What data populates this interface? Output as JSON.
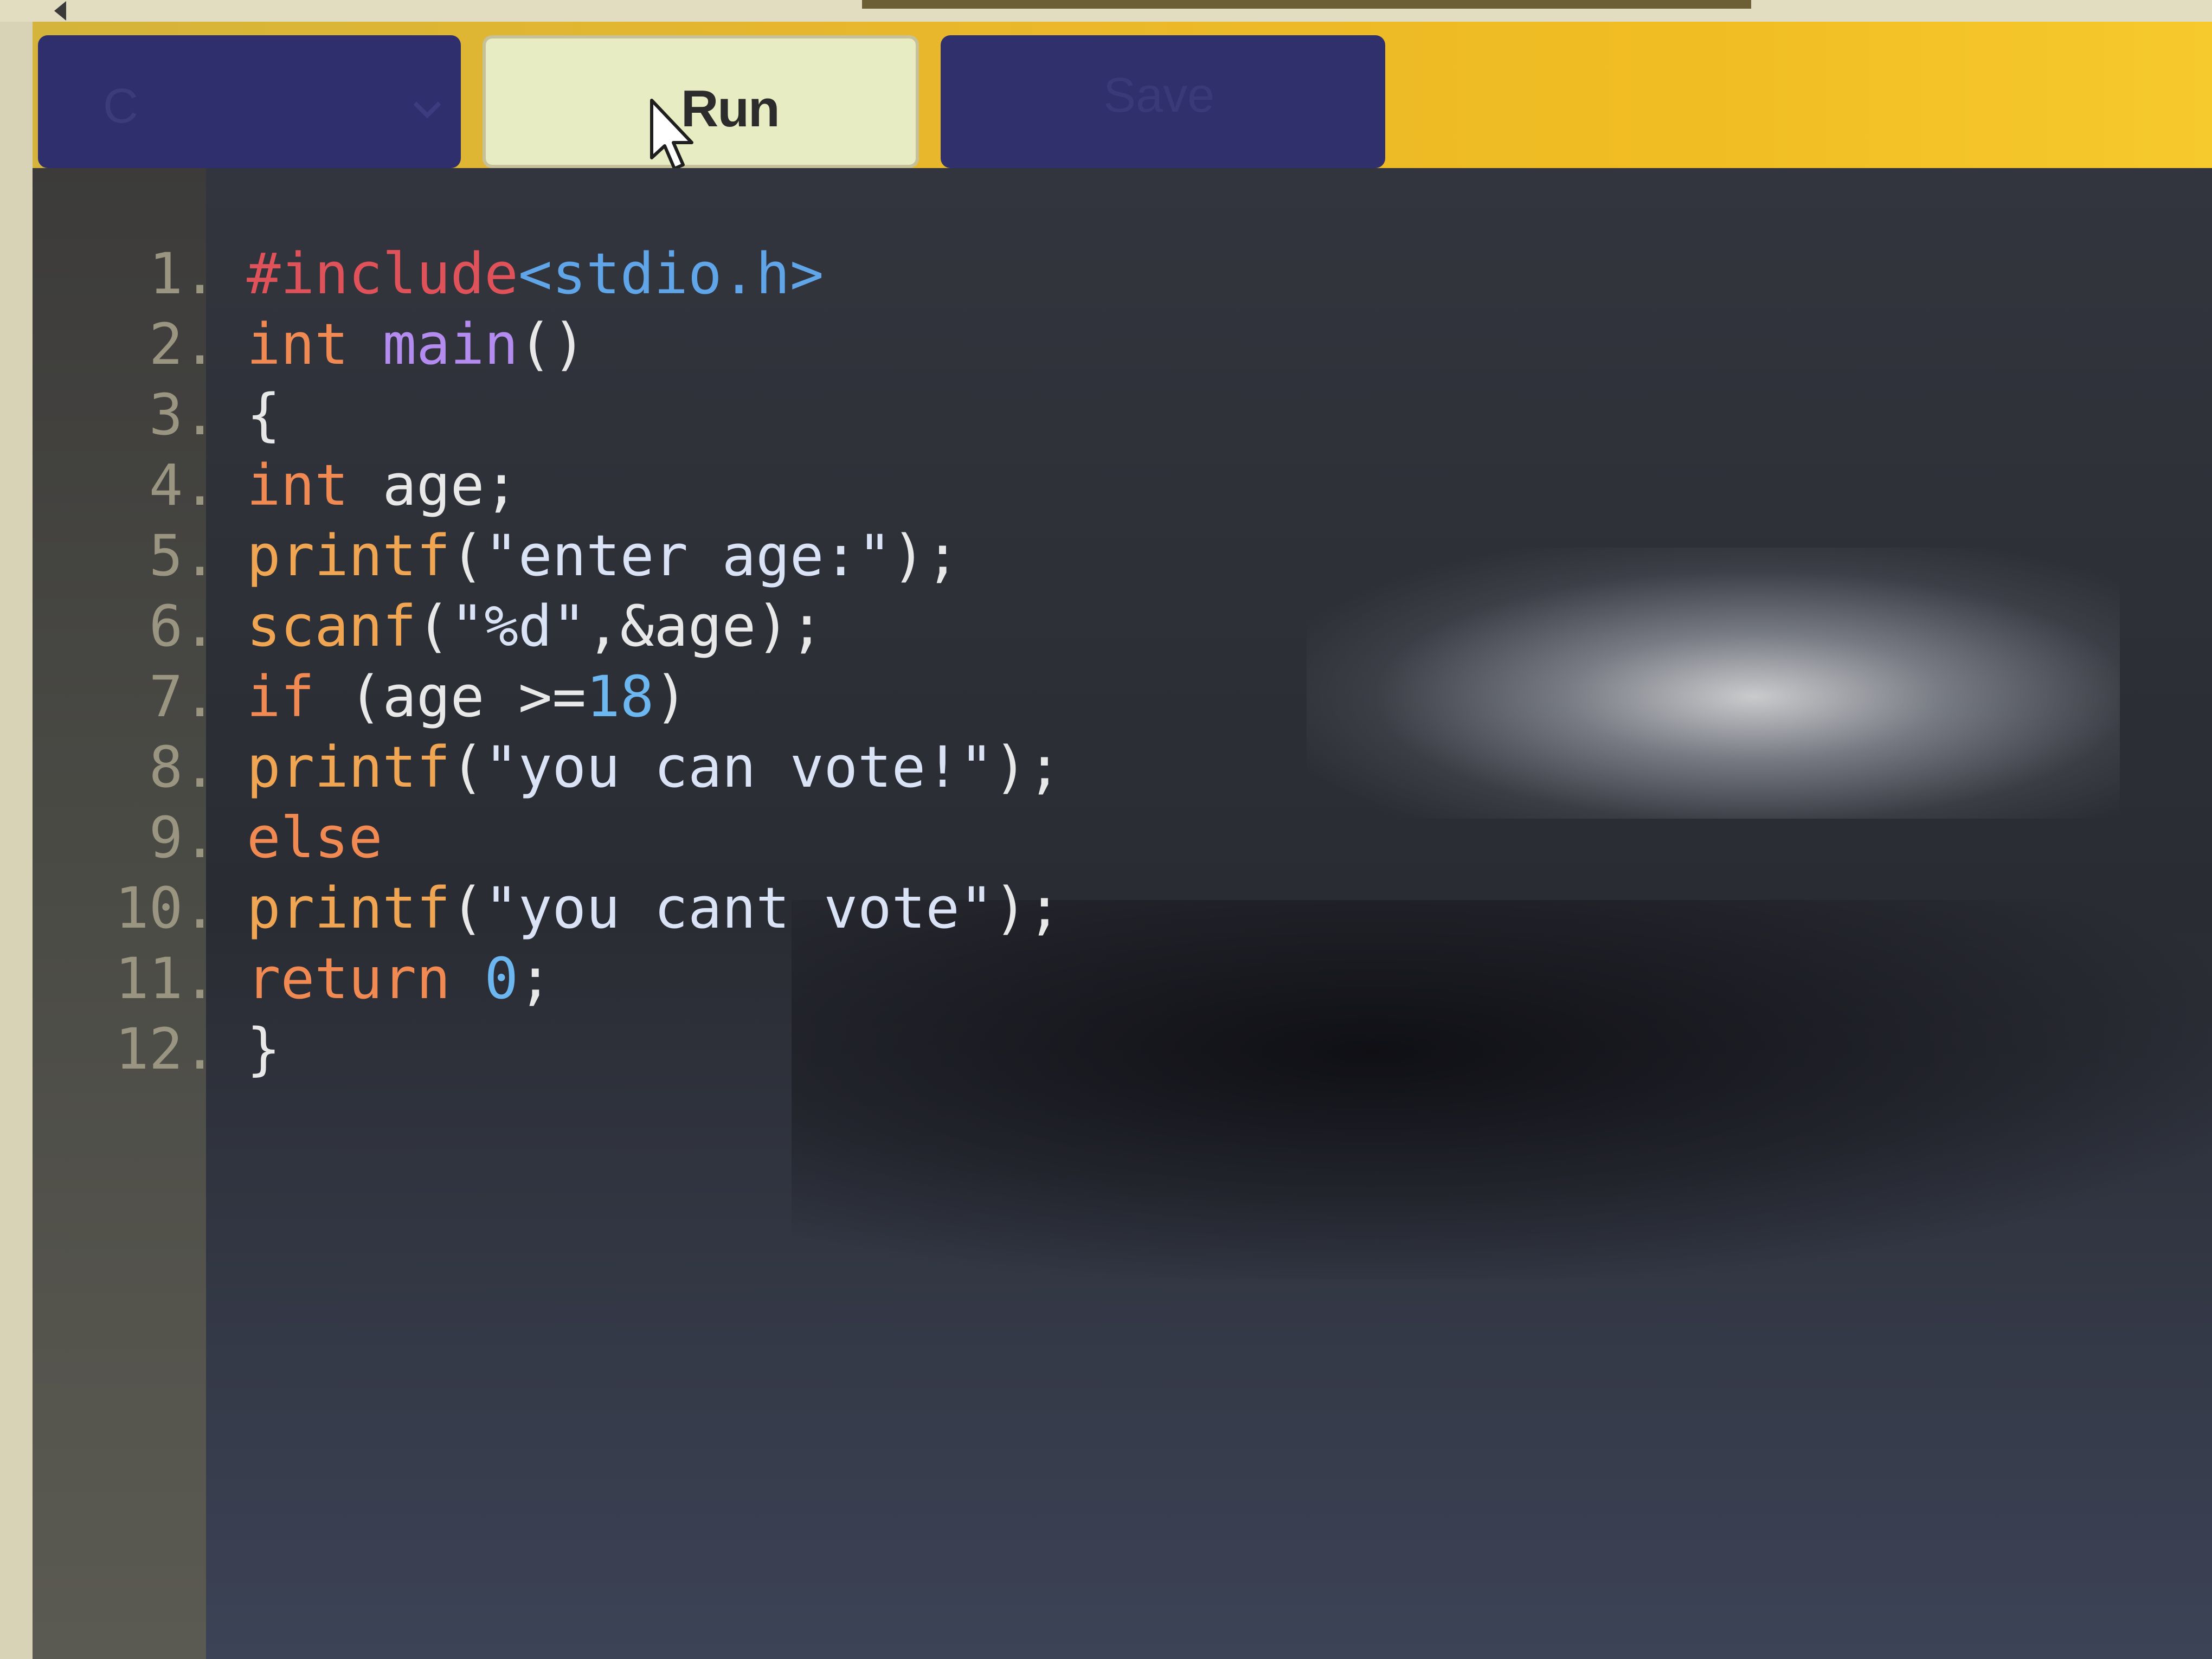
{
  "toolbar": {
    "language_select": "C",
    "run_label": "Run",
    "save_label": "Save"
  },
  "editor": {
    "language": "C",
    "lines": [
      {
        "num": "1.",
        "code": "#include<stdio.h>"
      },
      {
        "num": "2.",
        "code": "int main()"
      },
      {
        "num": "3.",
        "code": "{"
      },
      {
        "num": "4.",
        "code": "int age;"
      },
      {
        "num": "5.",
        "code": "printf(\"enter age:\");"
      },
      {
        "num": "6.",
        "code": "scanf(\"%d\",&age);"
      },
      {
        "num": "7.",
        "code": "if (age >=18)"
      },
      {
        "num": "8.",
        "code": "printf(\"you can vote!\");"
      },
      {
        "num": "9.",
        "code": "else"
      },
      {
        "num": "10.",
        "code": "printf(\"you cant vote\");"
      },
      {
        "num": "11.",
        "code": "return 0;"
      },
      {
        "num": "12.",
        "code": "}"
      }
    ]
  },
  "colors": {
    "toolbar_bg": "#f0bd22",
    "button_dark": "#2f2f6e",
    "run_button": "#e7ecc2",
    "editor_bg": "#2a2c33",
    "keyword": "#f08a52",
    "preprocessor": "#e0525a",
    "header": "#5fa5e8",
    "function_main": "#b48cf0",
    "number": "#6cb7f0"
  }
}
